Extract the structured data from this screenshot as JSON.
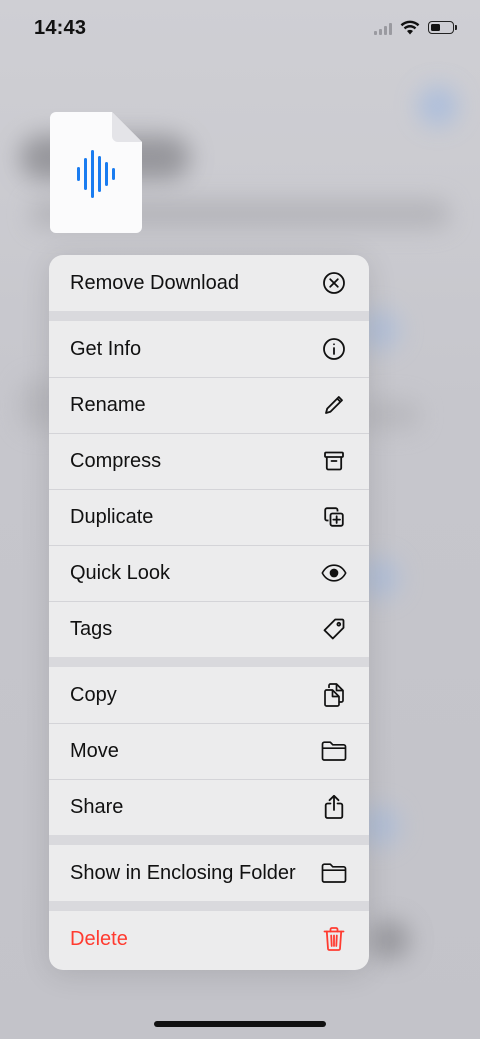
{
  "status_bar": {
    "time": "14:43"
  },
  "file_preview": {
    "icon": "audio-waveform-icon",
    "accent_color": "#1a7cf0"
  },
  "menu": {
    "groups": [
      [
        {
          "label": "Remove Download",
          "icon": "circle-x-icon"
        }
      ],
      [
        {
          "label": "Get Info",
          "icon": "info-icon"
        },
        {
          "label": "Rename",
          "icon": "pencil-icon"
        },
        {
          "label": "Compress",
          "icon": "archive-box-icon"
        },
        {
          "label": "Duplicate",
          "icon": "duplicate-icon"
        },
        {
          "label": "Quick Look",
          "icon": "eye-icon"
        },
        {
          "label": "Tags",
          "icon": "tag-icon"
        }
      ],
      [
        {
          "label": "Copy",
          "icon": "copy-icon"
        },
        {
          "label": "Move",
          "icon": "folder-icon"
        },
        {
          "label": "Share",
          "icon": "share-icon"
        }
      ],
      [
        {
          "label": "Show in Enclosing Folder",
          "icon": "folder-icon"
        }
      ],
      [
        {
          "label": "Delete",
          "icon": "trash-icon",
          "destructive": true
        }
      ]
    ],
    "destructive_color": "#ff3b30"
  }
}
